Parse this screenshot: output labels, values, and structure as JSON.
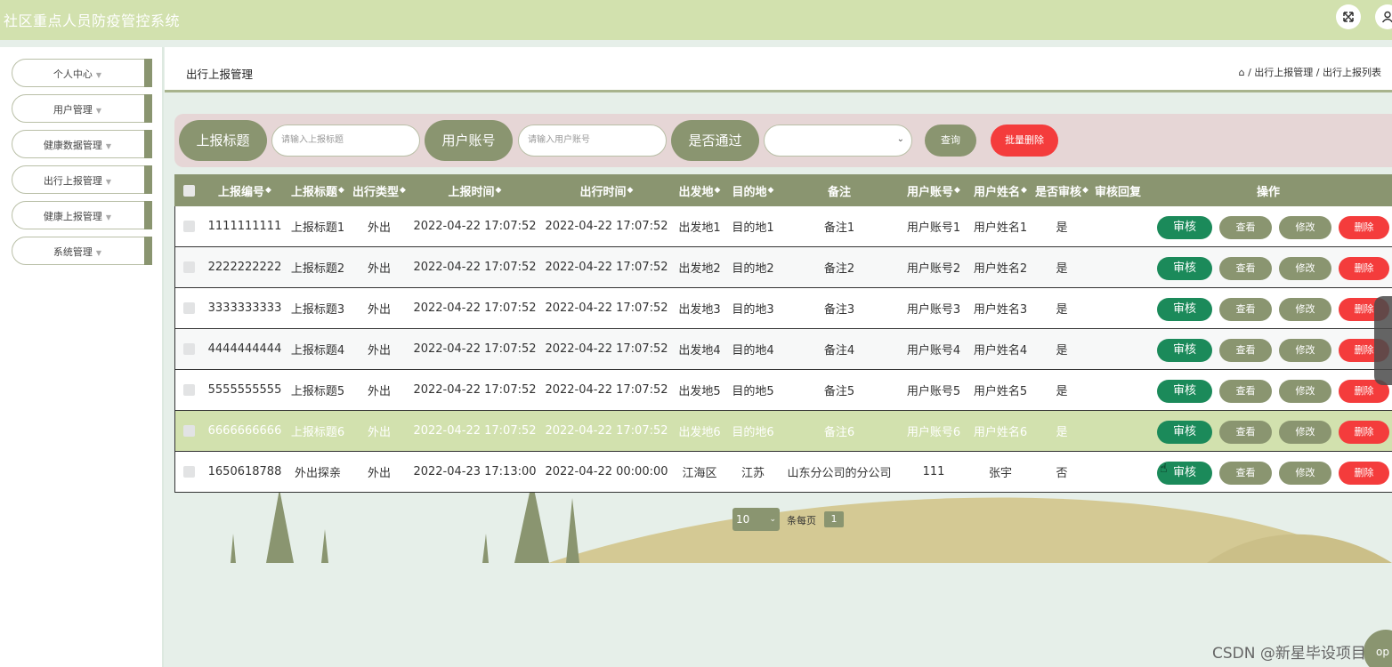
{
  "app": {
    "title": "社区重点人员防疫管控系统"
  },
  "header_icons": [
    {
      "name": "fullscreen-icon",
      "glyph": "⤧"
    },
    {
      "name": "user-icon",
      "glyph": "👤"
    }
  ],
  "sidebar": {
    "items": [
      {
        "label": "个人中心"
      },
      {
        "label": "用户管理"
      },
      {
        "label": "健康数据管理"
      },
      {
        "label": "出行上报管理"
      },
      {
        "label": "健康上报管理"
      },
      {
        "label": "系统管理"
      }
    ]
  },
  "page": {
    "title": "出行上报管理",
    "breadcrumb": "⌂ / 出行上报管理 / 出行上报列表"
  },
  "search": {
    "title_label": "上报标题",
    "title_placeholder": "请输入上报标题",
    "account_label": "用户账号",
    "account_placeholder": "请输入用户账号",
    "passed_label": "是否通过",
    "passed_value": "",
    "query_button": "查询",
    "batch_delete_button": "批量删除"
  },
  "table": {
    "columns": [
      "上报编号",
      "上报标题",
      "出行类型",
      "上报时间",
      "出行时间",
      "出发地",
      "目的地",
      "备注",
      "用户账号",
      "用户姓名",
      "是否审核",
      "审核回复",
      "操作"
    ],
    "sortable": [
      true,
      true,
      true,
      true,
      true,
      true,
      true,
      false,
      true,
      true,
      true,
      false,
      false
    ],
    "rows": [
      [
        "1111111111",
        "上报标题1",
        "外出",
        "2022-04-22 17:07:52",
        "2022-04-22 17:07:52",
        "出发地1",
        "目的地1",
        "备注1",
        "用户账号1",
        "用户姓名1",
        "是",
        ""
      ],
      [
        "2222222222",
        "上报标题2",
        "外出",
        "2022-04-22 17:07:52",
        "2022-04-22 17:07:52",
        "出发地2",
        "目的地2",
        "备注2",
        "用户账号2",
        "用户姓名2",
        "是",
        ""
      ],
      [
        "3333333333",
        "上报标题3",
        "外出",
        "2022-04-22 17:07:52",
        "2022-04-22 17:07:52",
        "出发地3",
        "目的地3",
        "备注3",
        "用户账号3",
        "用户姓名3",
        "是",
        ""
      ],
      [
        "4444444444",
        "上报标题4",
        "外出",
        "2022-04-22 17:07:52",
        "2022-04-22 17:07:52",
        "出发地4",
        "目的地4",
        "备注4",
        "用户账号4",
        "用户姓名4",
        "是",
        ""
      ],
      [
        "5555555555",
        "上报标题5",
        "外出",
        "2022-04-22 17:07:52",
        "2022-04-22 17:07:52",
        "出发地5",
        "目的地5",
        "备注5",
        "用户账号5",
        "用户姓名5",
        "是",
        ""
      ],
      [
        "6666666666",
        "上报标题6",
        "外出",
        "2022-04-22 17:07:52",
        "2022-04-22 17:07:52",
        "出发地6",
        "目的地6",
        "备注6",
        "用户账号6",
        "用户姓名6",
        "是",
        ""
      ],
      [
        "1650618788",
        "外出探亲",
        "外出",
        "2022-04-23 17:13:00",
        "2022-04-22 00:00:00",
        "江海区",
        "江苏",
        "山东分公司的分公司",
        "111",
        "张宇",
        "否",
        ""
      ]
    ],
    "highlighted_row": 5,
    "actions": {
      "audit": "审核",
      "view": "查看",
      "edit": "修改",
      "delete": "删除"
    }
  },
  "pagination": {
    "page_size": "10",
    "page_size_label": "条每页",
    "current_page": "1"
  },
  "overlay": {
    "top_button": "op",
    "watermark": "CSDN @新星毕设项目"
  },
  "colors": {
    "topbar": "#d2e1ae",
    "accent": "#8a9570",
    "danger": "#f43c3c",
    "audit": "#1b8a5a",
    "search_bg": "#e6d6d6",
    "scenery": "#d4c994"
  }
}
